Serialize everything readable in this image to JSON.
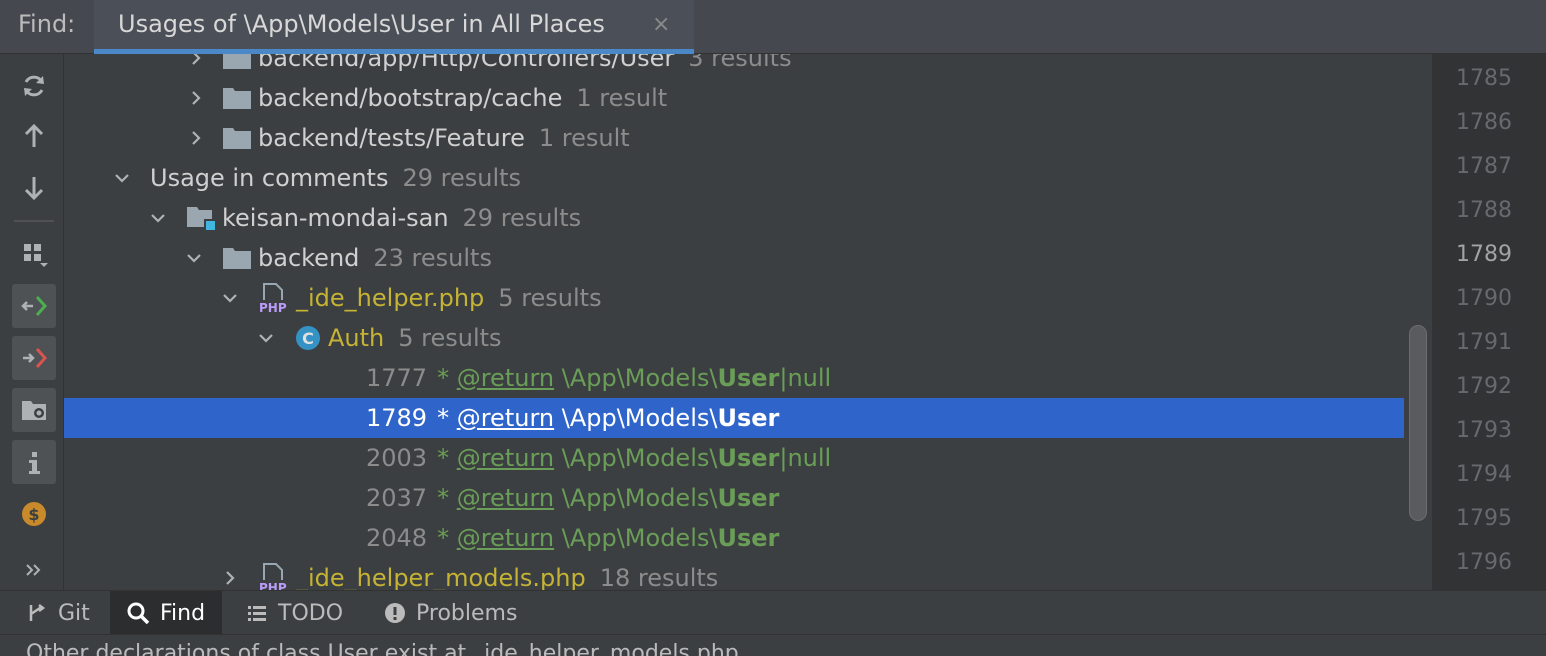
{
  "find": {
    "label": "Find:",
    "tab_title": "Usages of \\App\\Models\\User in All Places",
    "close_glyph": "×"
  },
  "tree": {
    "rows": [
      {
        "kind": "folder",
        "name": "backend/app/Http/Controllers/User",
        "count": "3 results",
        "expanded": false
      },
      {
        "kind": "folder",
        "name": "backend/bootstrap/cache",
        "count": "1 result",
        "expanded": false
      },
      {
        "kind": "folder",
        "name": "backend/tests/Feature",
        "count": "1 result",
        "expanded": false
      },
      {
        "kind": "group",
        "name": "Usage in comments",
        "count": "29 results",
        "expanded": true
      },
      {
        "kind": "module",
        "name": "keisan-mondai-san",
        "count": "29 results",
        "expanded": true
      },
      {
        "kind": "folder",
        "name": "backend",
        "count": "23 results",
        "expanded": true
      },
      {
        "kind": "php",
        "name": "_ide_helper.php",
        "count": "5 results",
        "expanded": true
      },
      {
        "kind": "class",
        "name": "Auth",
        "count": "5 results",
        "expanded": true
      },
      {
        "kind": "usage",
        "line": "1777",
        "star": "*",
        "tag": "@return",
        "path": "\\App\\Models\\",
        "bold": "User",
        "suffix": "|null"
      },
      {
        "kind": "usage",
        "line": "1789",
        "star": "*",
        "tag": "@return",
        "path": "\\App\\Models\\",
        "bold": "User",
        "suffix": "",
        "selected": true
      },
      {
        "kind": "usage",
        "line": "2003",
        "star": "*",
        "tag": "@return",
        "path": "\\App\\Models\\",
        "bold": "User",
        "suffix": "|null"
      },
      {
        "kind": "usage",
        "line": "2037",
        "star": "*",
        "tag": "@return",
        "path": "\\App\\Models\\",
        "bold": "User",
        "suffix": ""
      },
      {
        "kind": "usage",
        "line": "2048",
        "star": "*",
        "tag": "@return",
        "path": "\\App\\Models\\",
        "bold": "User",
        "suffix": ""
      },
      {
        "kind": "php",
        "name": "_ide_helper_models.php",
        "count": "18 results",
        "expanded": false
      }
    ]
  },
  "gutter": {
    "lines": [
      "1785",
      "1786",
      "1787",
      "1788",
      "1789",
      "1790",
      "1791",
      "1792",
      "1793",
      "1794",
      "1795",
      "1796"
    ],
    "current": "1789"
  },
  "bottom_tabs": [
    {
      "label": "Git",
      "icon": "git-branch-icon"
    },
    {
      "label": "Find",
      "icon": "search-icon",
      "active": true
    },
    {
      "label": "TODO",
      "icon": "list-icon"
    },
    {
      "label": "Problems",
      "icon": "warning-circle-icon"
    }
  ],
  "status": {
    "text": "Other declarations of class User exist at _ide_helper_models.php"
  },
  "colors": {
    "selection": "#2f65ca",
    "accent_tab_underline": "#4a88c7",
    "php_file": "#c4b334",
    "comment_usage": "#6a9e56"
  }
}
